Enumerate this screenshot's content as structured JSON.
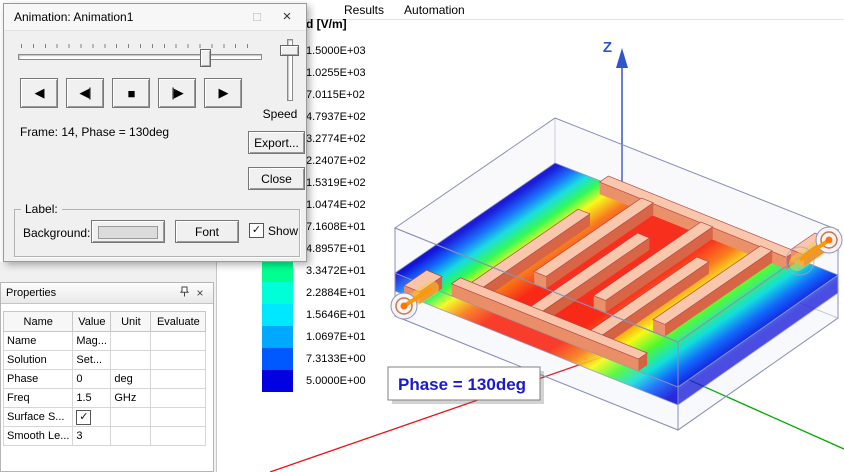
{
  "menu": {
    "items": [
      "Results",
      "Automation"
    ]
  },
  "animation_dialog": {
    "title": "Animation: Animation1",
    "maximize_glyph": "□",
    "close_glyph": "×",
    "frame_text": "Frame: 14, Phase = 130deg",
    "speed_label": "Speed",
    "export_label": "Export...",
    "close_label": "Close",
    "playback": [
      {
        "name": "play-reverse",
        "glyph": "◀"
      },
      {
        "name": "step-back",
        "glyph": "◀|"
      },
      {
        "name": "stop",
        "glyph": "■"
      },
      {
        "name": "step-forward",
        "glyph": "|▶"
      },
      {
        "name": "play-forward",
        "glyph": "▶"
      }
    ],
    "label_group": {
      "legend": "Label:",
      "background_label": "Background:",
      "font_label": "Font",
      "show_label": "Show",
      "show_checked": true
    }
  },
  "properties_panel": {
    "title": "Properties",
    "close_glyph": "×",
    "columns": [
      "Name",
      "Value",
      "Unit",
      "Evaluate"
    ],
    "rows": [
      {
        "name": "Name",
        "value": "Mag...",
        "unit": "",
        "evaluate": ""
      },
      {
        "name": "Solution",
        "value": "Set...",
        "unit": "",
        "evaluate": ""
      },
      {
        "name": "Phase",
        "value": "0",
        "unit": "deg",
        "evaluate": ""
      },
      {
        "name": "Freq",
        "value": "1.5",
        "unit": "GHz",
        "evaluate": ""
      },
      {
        "name": "Surface S...",
        "value": "",
        "checkbox": true,
        "checked": true,
        "unit": "",
        "evaluate": ""
      },
      {
        "name": "Smooth Le...",
        "value": "3",
        "unit": "",
        "evaluate": ""
      }
    ]
  },
  "legend": {
    "title": "d [V/m]",
    "entries": [
      {
        "value": "1.5000E+03",
        "color": "#ff0000"
      },
      {
        "value": "1.0255E+03",
        "color": "#ff4800"
      },
      {
        "value": "7.0115E+02",
        "color": "#ff8800"
      },
      {
        "value": "4.7937E+02",
        "color": "#ffc000"
      },
      {
        "value": "3.2774E+02",
        "color": "#ffff00"
      },
      {
        "value": "2.2407E+02",
        "color": "#c0ff00"
      },
      {
        "value": "1.5319E+02",
        "color": "#80ff00"
      },
      {
        "value": "1.0474E+02",
        "color": "#40ff00"
      },
      {
        "value": "7.1608E+01",
        "color": "#00ff00"
      },
      {
        "value": "4.8957E+01",
        "color": "#00ff48"
      },
      {
        "value": "3.3472E+01",
        "color": "#00ff90"
      },
      {
        "value": "2.2884E+01",
        "color": "#00ffd8"
      },
      {
        "value": "1.5646E+01",
        "color": "#00e8ff"
      },
      {
        "value": "1.0697E+01",
        "color": "#00a8ff"
      },
      {
        "value": "7.3133E+00",
        "color": "#0058ff"
      },
      {
        "value": "5.0000E+00",
        "color": "#0000e0"
      }
    ]
  },
  "viewport": {
    "phase_label": "Phase = 130deg",
    "phase_text_color": "#1a1acc",
    "z_axis_label": "Z",
    "axes": {
      "x_color": "#ee1111",
      "y_color": "#00aa00",
      "z_color": "#3355cc"
    }
  }
}
